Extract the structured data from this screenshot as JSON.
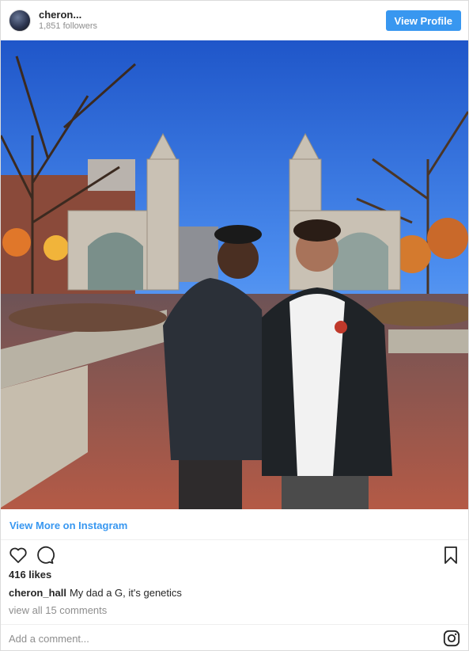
{
  "header": {
    "username": "cheron...",
    "followers": "1,851 followers",
    "view_profile": "View Profile",
    "avatar_icon": "avatar-photo"
  },
  "photo": {
    "subject": "photo-two-people-in-front-of-stone-gates"
  },
  "view_more": "View More on Instagram",
  "actions": {
    "like_icon": "heart-icon",
    "comment_icon": "comment-bubble-icon",
    "save_icon": "bookmark-icon"
  },
  "likes": "416 likes",
  "caption": {
    "user": "cheron_hall",
    "text": "My dad a G, it's genetics"
  },
  "comments_link": "view all 15 comments",
  "add_comment": {
    "placeholder": "Add a comment...",
    "instagram_icon": "instagram-logo-icon"
  },
  "colors": {
    "accent": "#3897f0",
    "muted": "#8e8e8e",
    "text": "#262626"
  }
}
